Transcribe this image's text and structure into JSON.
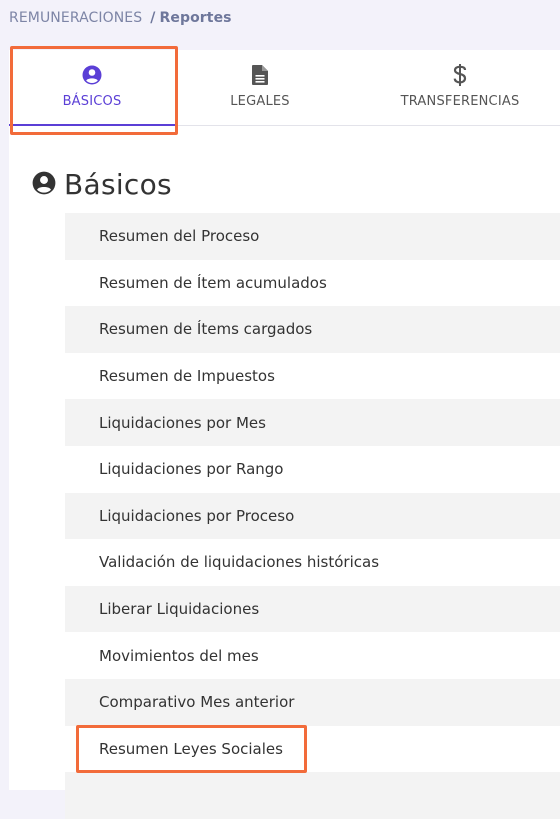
{
  "breadcrumb": {
    "parent": "REMUNERACIONES",
    "separator": "/",
    "current": "Reportes"
  },
  "tabs": [
    {
      "label": "BÁSICOS",
      "icon": "user-circle-icon",
      "active": true
    },
    {
      "label": "LEGALES",
      "icon": "document-icon",
      "active": false
    },
    {
      "label": "TRANSFERENCIAS",
      "icon": "dollar-icon",
      "active": false
    }
  ],
  "section": {
    "title": "Básicos",
    "icon": "user-circle-icon"
  },
  "reports": [
    "Resumen del Proceso",
    "Resumen de Ítem acumulados",
    "Resumen de Ítems cargados",
    "Resumen de Impuestos",
    "Liquidaciones por Mes",
    "Liquidaciones por Rango",
    "Liquidaciones por Proceso",
    "Validación de liquidaciones históricas",
    "Liberar Liquidaciones",
    "Movimientos del mes",
    "Comparativo Mes anterior",
    "Resumen Leyes Sociales",
    ""
  ],
  "colors": {
    "accent": "#5b3fd6",
    "highlight": "#f26b3a",
    "page_bg": "#f3f2fa"
  }
}
